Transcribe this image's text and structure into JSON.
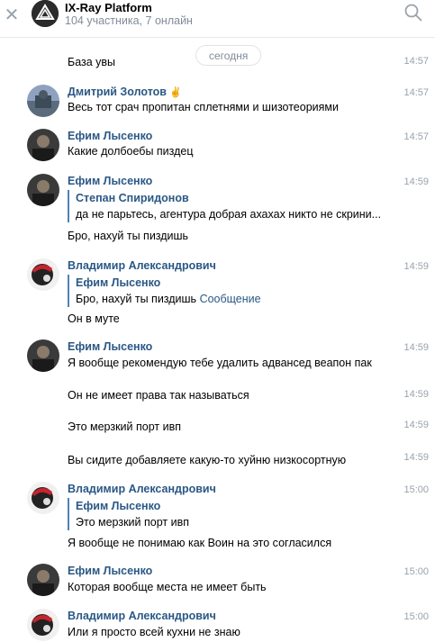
{
  "header": {
    "title": "IX-Ray Platform",
    "subtitle": "104 участника, 7 онлайн"
  },
  "date_separator": "сегодня",
  "messages": [
    {
      "text": "База увы",
      "time": "14:57"
    },
    {
      "author": "Дмитрий Золотов",
      "badge": "✌",
      "text": "Весь тот срач пропитан сплетнями и шизотеориями",
      "time": "14:57"
    },
    {
      "author": "Ефим Лысенко",
      "text": "Какие долбоебы пиздец",
      "time": "14:57"
    },
    {
      "author": "Ефим Лысенко",
      "quote_author": "Степан Спиридонов",
      "quote_text": "да не парьтесь, агентура добрая ахахах никто не скрини...",
      "text": "Бро, нахуй ты пиздишь",
      "time": "14:59"
    },
    {
      "author": "Владимир Александрович",
      "quote_author": "Ефим Лысенко",
      "quote_text": "Бро, нахуй ты пиздишь",
      "quote_link": "Сообщение",
      "text": "Он в муте",
      "time": "14:59"
    },
    {
      "author": "Ефим Лысенко",
      "text": "Я вообще рекомендую тебе удалить адвансед веапон пак",
      "time": "14:59"
    },
    {
      "text": "Он не имеет права так называться",
      "time": "14:59"
    },
    {
      "text": "Это мерзкий порт ивп",
      "time": "14:59"
    },
    {
      "text": "Вы сидите добавляете какую-то хуйню низкосортную",
      "time": "14:59"
    },
    {
      "author": "Владимир Александрович",
      "quote_author": "Ефим Лысенко",
      "quote_text": "Это мерзкий порт ивп",
      "text": "Я вообще не понимаю как Воин на это согласился",
      "time": "15:00"
    },
    {
      "author": "Ефим Лысенко",
      "text": "Которая вообще места не имеет быть",
      "time": "15:00"
    },
    {
      "author": "Владимир Александрович",
      "text": "Или я просто всей кухни не знаю",
      "time": "15:00"
    }
  ]
}
